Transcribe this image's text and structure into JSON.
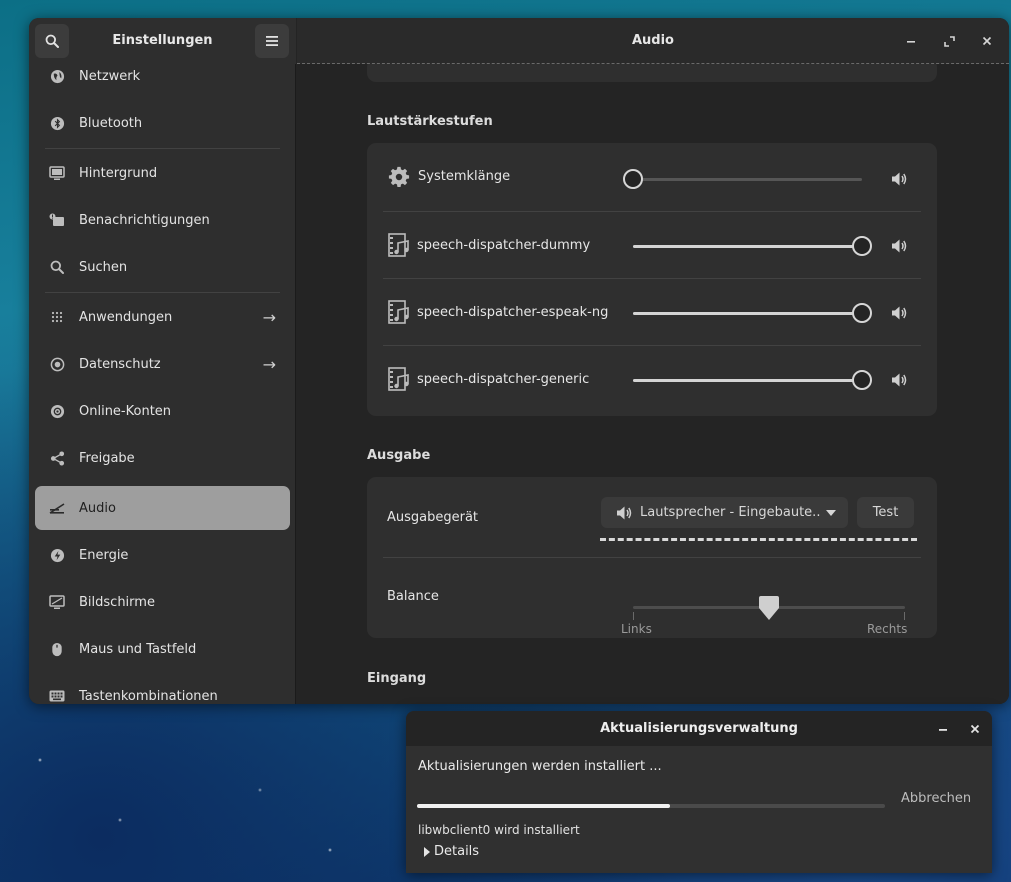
{
  "settings": {
    "sidebar_title": "Einstellungen",
    "page_title": "Audio",
    "sidebar_items": [
      {
        "label": "Netzwerk",
        "icon": "globe-icon"
      },
      {
        "label": "Bluetooth",
        "icon": "bluetooth-icon"
      },
      {
        "label": "Hintergrund",
        "icon": "monitor-image-icon"
      },
      {
        "label": "Benachrichtigungen",
        "icon": "notification-icon"
      },
      {
        "label": "Suchen",
        "icon": "search-icon"
      },
      {
        "label": "Anwendungen",
        "icon": "apps-grid-icon",
        "arrow": "→"
      },
      {
        "label": "Datenschutz",
        "icon": "privacy-icon",
        "arrow": "→"
      },
      {
        "label": "Online-Konten",
        "icon": "at-icon"
      },
      {
        "label": "Freigabe",
        "icon": "share-icon"
      },
      {
        "label": "Audio",
        "icon": "audio-icon",
        "active": true
      },
      {
        "label": "Energie",
        "icon": "power-icon"
      },
      {
        "label": "Bildschirme",
        "icon": "display-icon"
      },
      {
        "label": "Maus und Tastfeld",
        "icon": "mouse-icon"
      },
      {
        "label": "Tastenkombinationen",
        "icon": "keyboard-icon"
      }
    ],
    "volume_levels": {
      "title": "Lautstärkestufen",
      "rows": [
        {
          "label": "Systemklänge",
          "icon": "gear-icon",
          "level": 0.0
        },
        {
          "label": "speech-dispatcher-dummy",
          "icon": "media-file-icon",
          "level": 1.0
        },
        {
          "label": "speech-dispatcher-espeak-ng",
          "icon": "media-file-icon",
          "level": 1.0
        },
        {
          "label": "speech-dispatcher-generic",
          "icon": "media-file-icon",
          "level": 1.0
        }
      ]
    },
    "output": {
      "title": "Ausgabe",
      "device_label": "Ausgabegerät",
      "device_value": "Lautsprecher - Eingebaute...",
      "test_label": "Test",
      "balance_label": "Balance",
      "balance_left": "Links",
      "balance_right": "Rechts",
      "balance_value": 0.5
    },
    "input": {
      "title": "Eingang"
    }
  },
  "update_dialog": {
    "title": "Aktualisierungsverwaltung",
    "status": "Aktualisierungen werden installiert ...",
    "cancel_label": "Abbrechen",
    "progress": 0.54,
    "detail_text": "libwbclient0 wird installiert",
    "details_label": "Details"
  },
  "colors": {
    "accent_active": "#9e9e9e",
    "window_bg": "#242424",
    "card_bg": "#2f2f2f"
  }
}
